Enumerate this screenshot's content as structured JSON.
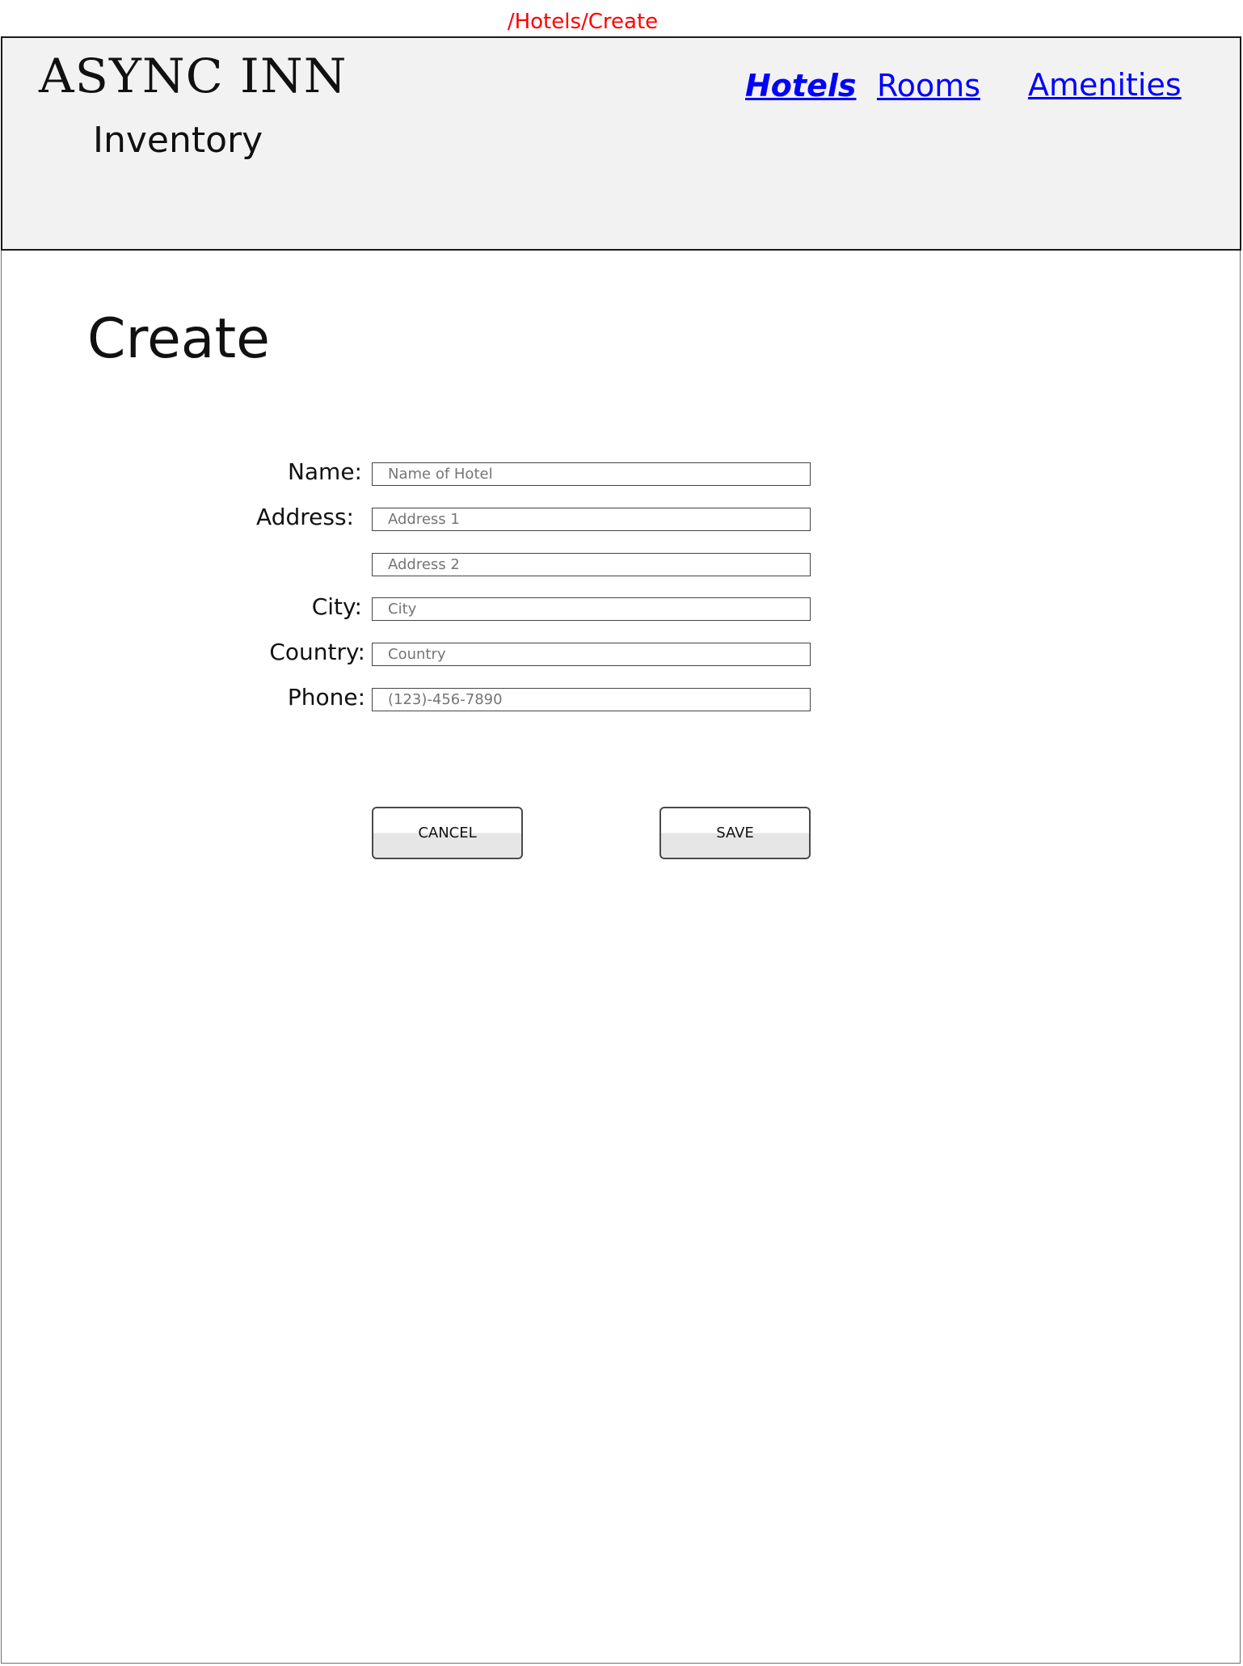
{
  "route": "/Hotels/Create",
  "header": {
    "brand": "ASYNC INN",
    "subtitle": "Inventory",
    "nav": {
      "hotels": "Hotels",
      "rooms": "Rooms",
      "amenities": "Amenities"
    }
  },
  "page": {
    "title": "Create"
  },
  "form": {
    "name": {
      "label": "Name:",
      "placeholder": "Name of Hotel"
    },
    "address": {
      "label": "Address:",
      "placeholder1": "Address 1",
      "placeholder2": "Address 2"
    },
    "city": {
      "label": "City:",
      "placeholder": "City"
    },
    "country": {
      "label": "Country:",
      "placeholder": "Country"
    },
    "phone": {
      "label": "Phone:",
      "placeholder": "(123)-456-7890"
    }
  },
  "buttons": {
    "cancel": "CANCEL",
    "save": "SAVE"
  },
  "colors": {
    "route": "#ff0000",
    "link": "#0000ff",
    "header_bg": "#f2f2f2"
  }
}
